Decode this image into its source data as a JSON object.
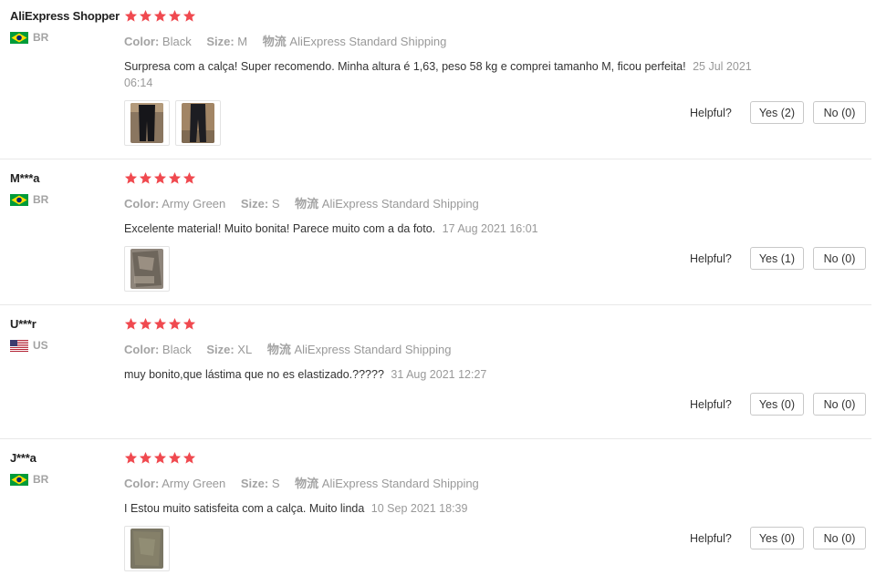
{
  "helpful_label": "Helpful?",
  "meta_labels": {
    "color": "Color:",
    "size": "Size:",
    "shipping": "物流"
  },
  "colors": {
    "star": "#f0494f",
    "date": "#999999",
    "label": "#a3a3a3"
  },
  "reviews": [
    {
      "user": "AliExpress Shopper",
      "country": "BR",
      "flag": "brazil-flag-icon",
      "rating": 5,
      "color": "Black",
      "size": "M",
      "shipping": "AliExpress Standard Shipping",
      "text": "Surpresa com a calça! Super recomendo. Minha altura é 1,63, peso 58 kg e comprei tamanho M, ficou perfeita!",
      "date": "25 Jul 2021 06:14",
      "images": [
        "black-pants-photo",
        "black-pants-photo"
      ],
      "yes": "Yes (2)",
      "no": "No (0)"
    },
    {
      "user": "M***a",
      "country": "BR",
      "flag": "brazil-flag-icon",
      "rating": 5,
      "color": "Army Green",
      "size": "S",
      "shipping": "AliExpress Standard Shipping",
      "text": "Excelente material! Muito bonita! Parece muito com a da foto.",
      "date": "17 Aug 2021 16:01",
      "images": [
        "green-pants-photo"
      ],
      "yes": "Yes (1)",
      "no": "No (0)"
    },
    {
      "user": "U***r",
      "country": "US",
      "flag": "us-flag-icon",
      "rating": 5,
      "color": "Black",
      "size": "XL",
      "shipping": "AliExpress Standard Shipping",
      "text": "muy bonito,que lástima que no es elastizado.?????",
      "date": "31 Aug 2021 12:27",
      "images": [],
      "yes": "Yes (0)",
      "no": "No (0)"
    },
    {
      "user": "J***a",
      "country": "BR",
      "flag": "brazil-flag-icon",
      "rating": 5,
      "color": "Army Green",
      "size": "S",
      "shipping": "AliExpress Standard Shipping",
      "text": "I Estou muito satisfeita com a calça. Muito linda",
      "date": "10 Sep 2021 18:39",
      "images": [
        "green-pants-photo"
      ],
      "yes": "Yes (0)",
      "no": "No (0)"
    }
  ]
}
